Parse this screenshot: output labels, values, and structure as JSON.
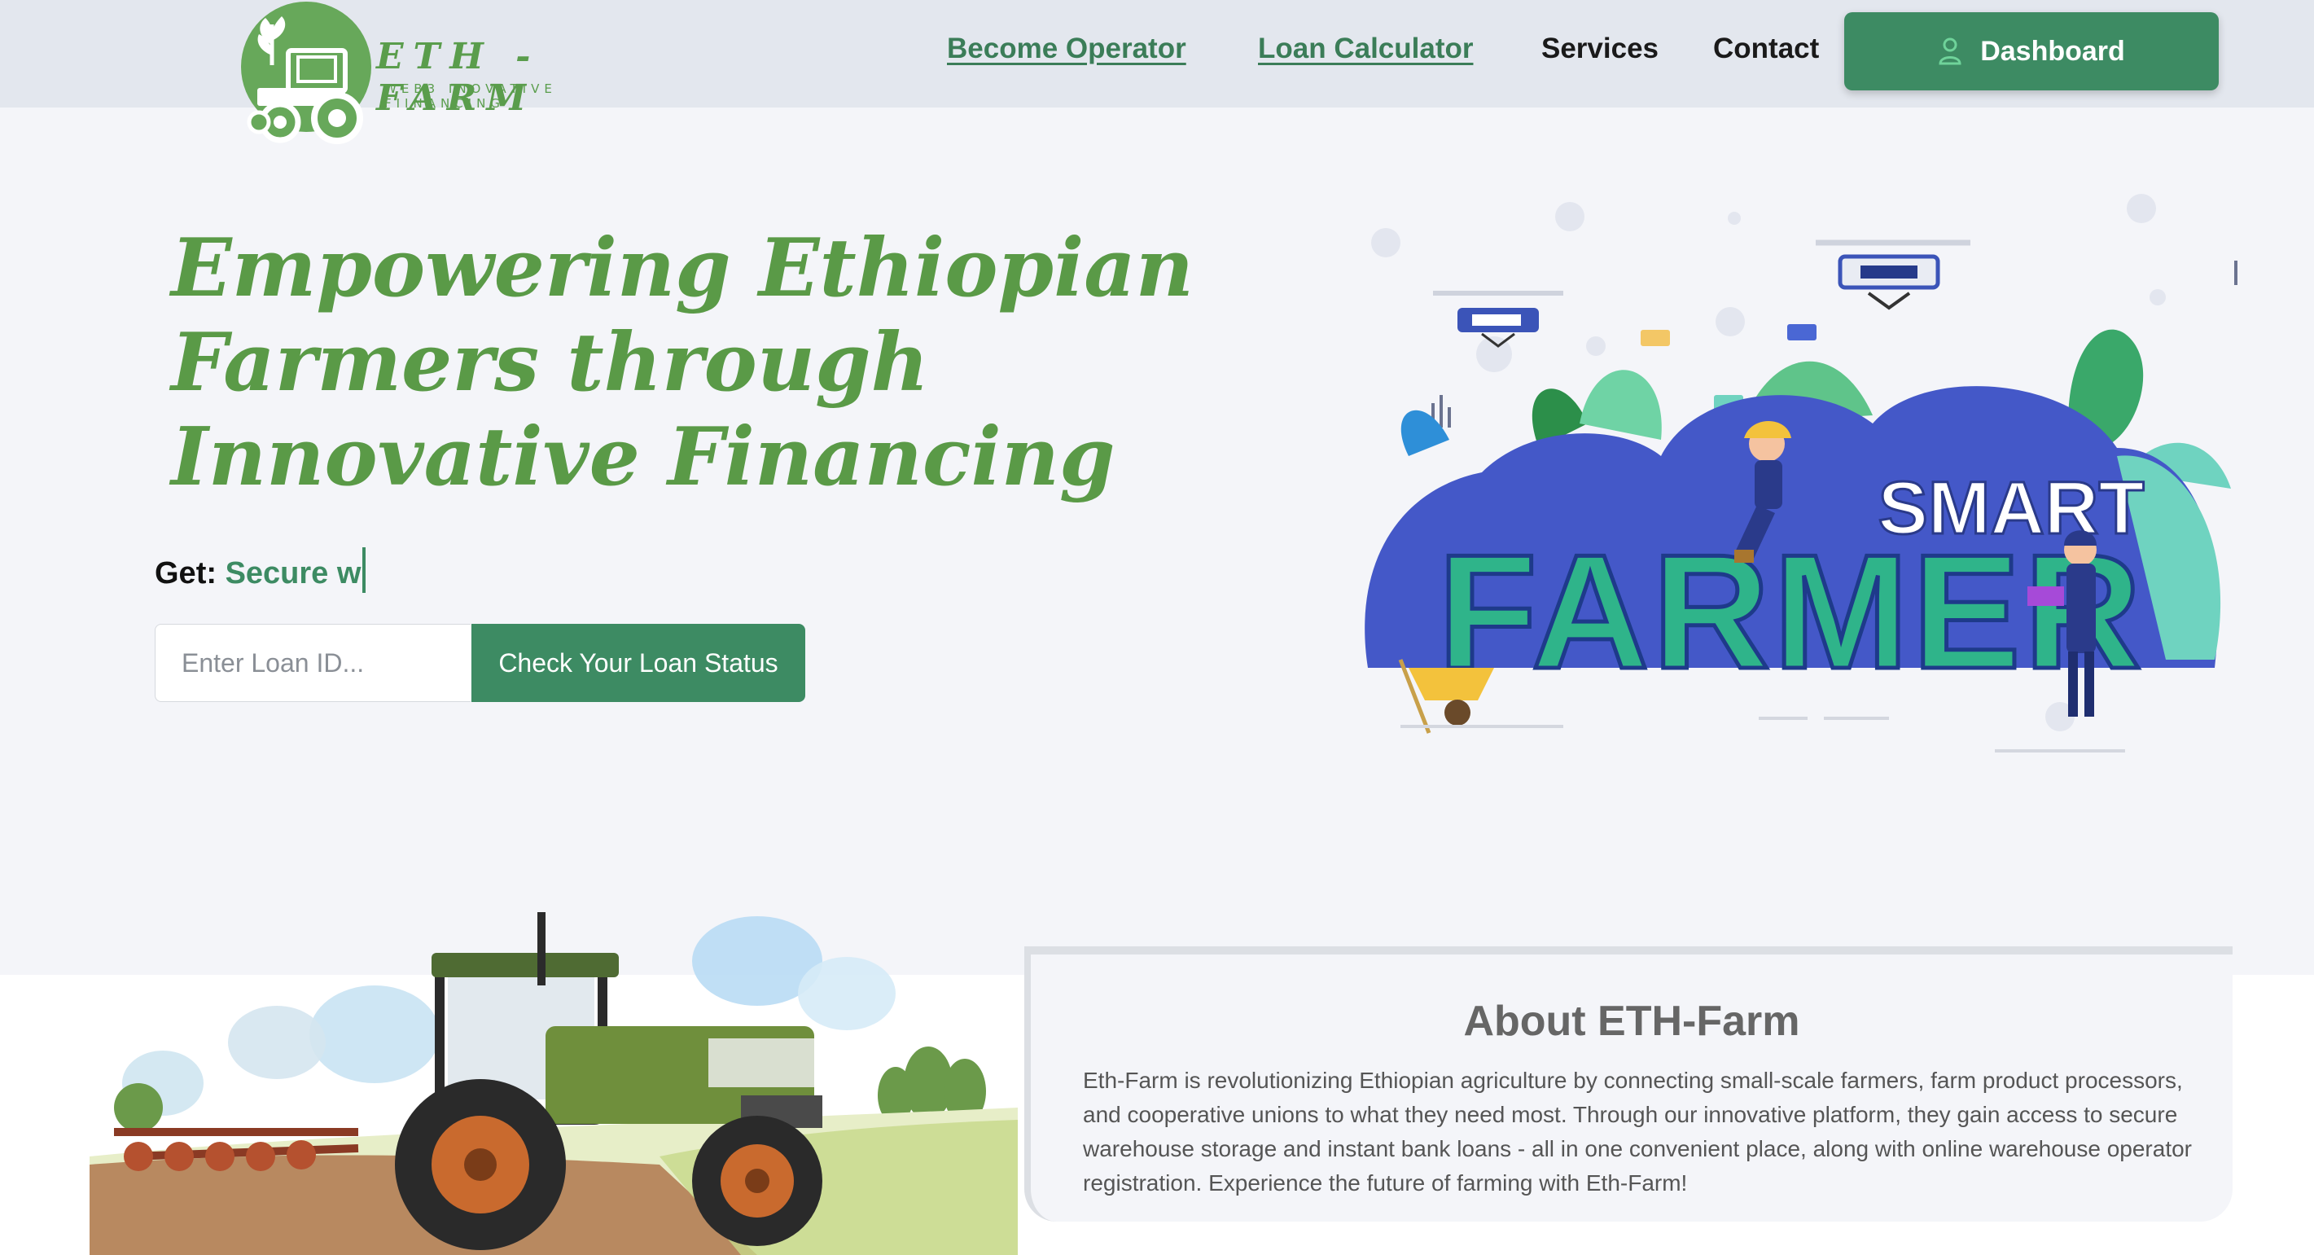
{
  "brand": {
    "name": "ETH - FARM",
    "tagline": "WEB3 INOVATIVE FIINANCING",
    "logo_icon": "tractor-sprout-logo",
    "color_primary": "#3d8b63",
    "color_brand_green": "#5a9d4c"
  },
  "nav": {
    "become_operator": "Become Operator",
    "loan_calculator": "Loan Calculator",
    "services": "Services",
    "contact": "Contact",
    "dashboard": "Dashboard",
    "dashboard_icon": "user-icon"
  },
  "hero": {
    "title": "Empowering Ethiopian Farmers through Innovative Financing",
    "get_label": "Get:",
    "get_value": "Secure w",
    "loan_input_placeholder": "Enter Loan ID...",
    "loan_input_value": "",
    "check_button": "Check Your Loan Status",
    "illustration_text_top": "SMART",
    "illustration_text_bottom": "FARMER"
  },
  "about": {
    "title": "About ETH-Farm",
    "body": "Eth-Farm is revolutionizing Ethiopian agriculture by connecting small-scale farmers, farm product processors, and cooperative unions to what they need most. Through our innovative platform, they gain access to secure warehouse storage and instant bank loans - all in one convenient place, along with online warehouse operator registration. Experience the future of farming with Eth-Farm!"
  }
}
